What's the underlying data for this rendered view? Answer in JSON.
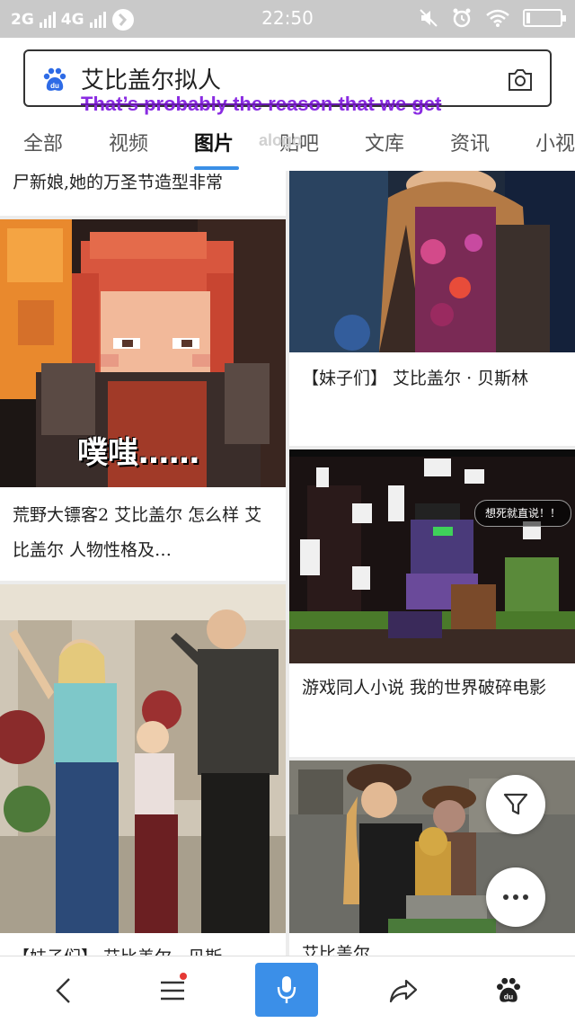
{
  "status_bar": {
    "network1": "2G",
    "network2": "4G",
    "time": "22:50"
  },
  "search": {
    "query": "艾比盖尔拟人",
    "overlay_caption": "That’s probably the reason that we get"
  },
  "tabs": [
    "全部",
    "视频",
    "图片",
    "贴吧",
    "文库",
    "资讯",
    "小视频"
  ],
  "active_tab": "图片",
  "watermark": "alogo",
  "feed": {
    "left": [
      {
        "caption": "尸新娘,她的万圣节造型非常"
      },
      {
        "overlay_text": "噗嗤……",
        "caption": "荒野大镖客2 艾比盖尔 怎么样  艾比盖尔 人物性格及…"
      },
      {
        "caption": "【妹子们】 艾比盖尔 · 贝斯"
      }
    ],
    "right": [
      {
        "caption": "【妹子们】 艾比盖尔 · 贝斯林"
      },
      {
        "bubble_text": "想死就直说！！",
        "caption": "游戏同人小说 我的世界破碎电影"
      },
      {
        "caption": "艾比盖尔"
      }
    ]
  },
  "colors": {
    "accent": "#3b8fe8",
    "caption_overlay": "#8a2be2",
    "tab_underline": "#3a8fe6"
  }
}
